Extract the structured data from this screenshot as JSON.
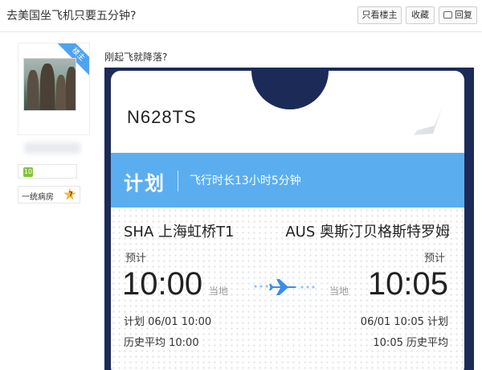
{
  "thread": {
    "title": "去美国坐飞机只要五分钟?",
    "buttons": {
      "only_owner": "只看楼主",
      "favorite": "收藏",
      "reply": "回复"
    }
  },
  "author": {
    "ribbon": "楼主",
    "level": "10",
    "honor_title": "一统病房",
    "honor_level": "7"
  },
  "post": {
    "text": "刚起飞就降落?"
  },
  "flight_card": {
    "registration": "N628TS",
    "status_label": "计划",
    "duration": "飞行时长13小时5分钟",
    "departure": {
      "airport": "SHA 上海虹桥T1",
      "status": "预计",
      "time": "10:00",
      "local_label": "当地",
      "planned": "计划 06/01 10:00",
      "historical_avg": "历史平均 10:00"
    },
    "arrival": {
      "airport": "AUS 奥斯汀贝格斯特罗姆",
      "status": "预计",
      "time": "10:05",
      "local_label": "当地",
      "planned": "06/01 10:05 计划",
      "historical_avg": "10:05 历史平均"
    },
    "colors": {
      "status_bar": "#5aaef0",
      "plane": "#3a8de6",
      "frame": "#1b2a57"
    }
  }
}
